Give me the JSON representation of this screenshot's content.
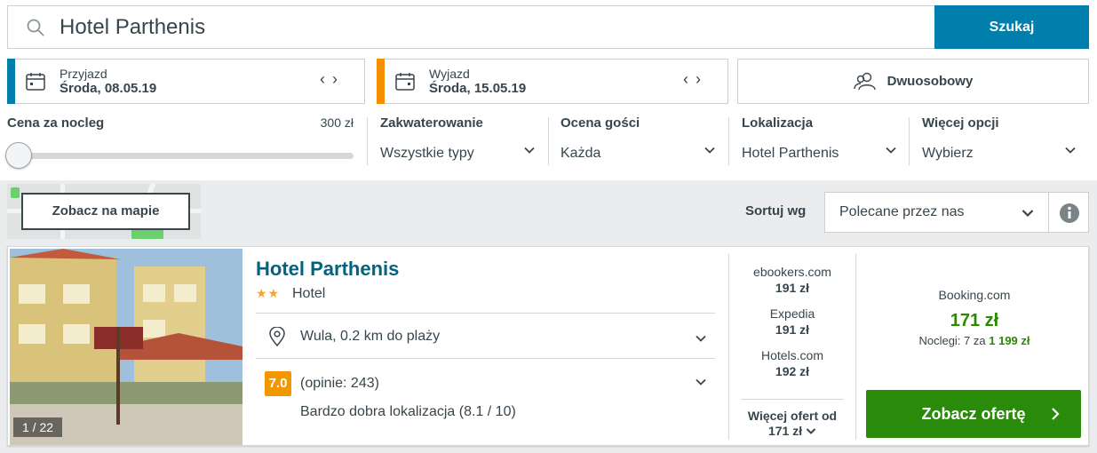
{
  "search": {
    "value": "Hotel Parthenis",
    "button": "Szukaj"
  },
  "checkin": {
    "label": "Przyjazd",
    "value": "Środa, 08.05.19",
    "accent": "#007fad"
  },
  "checkout": {
    "label": "Wyjazd",
    "value": "Środa, 15.05.19",
    "accent": "#f48f00"
  },
  "room": {
    "label": "Dwuosobowy"
  },
  "filters": {
    "price": {
      "title": "Cena za nocleg",
      "max": "300 zł"
    },
    "accommodation": {
      "title": "Zakwaterowanie",
      "value": "Wszystkie typy"
    },
    "rating": {
      "title": "Ocena gości",
      "value": "Każda"
    },
    "location": {
      "title": "Lokalizacja",
      "value": "Hotel Parthenis"
    },
    "more": {
      "title": "Więcej opcji",
      "value": "Wybierz"
    }
  },
  "map_button": "Zobacz na mapie",
  "sort": {
    "label": "Sortuj wg",
    "value": "Polecane przez nas"
  },
  "hotel": {
    "name": "Hotel Parthenis",
    "stars": "★★",
    "type": "Hotel",
    "photo_count": "1 / 22",
    "location": "Wula, 0.2 km do plaży",
    "rating": "7.0",
    "reviews": "(opinie: 243)",
    "location_rating": "Bardzo dobra lokalizacja (8.1 / 10)",
    "providers": [
      {
        "name": "ebookers.com",
        "price": "191 zł"
      },
      {
        "name": "Expedia",
        "price": "191 zł"
      },
      {
        "name": "Hotels.com",
        "price": "192 zł"
      }
    ],
    "more_offers_line1": "Więcej ofert od",
    "more_offers_line2": "171 zł",
    "best": {
      "site": "Booking.com",
      "price": "171 zł",
      "note_prefix": "Noclegi: 7 za",
      "note_total": "1 199 zł"
    },
    "cta": "Zobacz ofertę"
  }
}
